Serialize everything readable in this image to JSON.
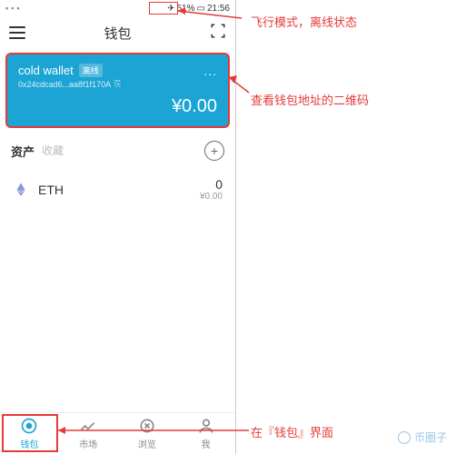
{
  "status": {
    "battery": "51%",
    "time": "21:56"
  },
  "header": {
    "title": "钱包"
  },
  "wallet": {
    "name": "cold wallet",
    "tag": "离线",
    "address": "0x24cdcad6...aa8f1f170A",
    "balance": "¥0.00",
    "more": "..."
  },
  "section": {
    "assets": "资产",
    "collectibles": "收藏"
  },
  "asset": {
    "name": "ETH",
    "amount": "0",
    "value": "¥0.00"
  },
  "nav": {
    "wallet": "钱包",
    "market": "市场",
    "browse": "浏览",
    "me": "我"
  },
  "annotations": {
    "airplane": "飞行模式，离线状态",
    "qrcode": "查看钱包地址的二维码",
    "wallettab": "在『钱包』界面"
  },
  "watermark": "币圈子"
}
